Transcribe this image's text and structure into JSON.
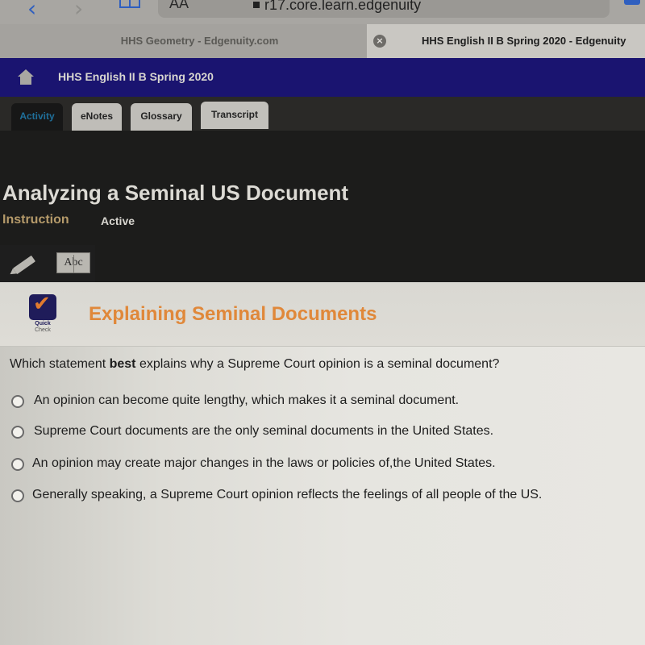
{
  "browser": {
    "toolbar": {
      "back_icon": "chevron-left",
      "forward_icon": "chevron-right",
      "bookmarks_icon": "open-book",
      "reader_label": "AA",
      "url": "r17.core.learn.edgenuity"
    },
    "tabs": [
      {
        "label": "HHS Geometry - Edgenuity.com",
        "active": false
      },
      {
        "label": "HHS English II B Spring 2020 - Edgenuity",
        "active": true,
        "close_icon": "x-circle"
      }
    ]
  },
  "course": {
    "home_icon": "home",
    "title": "HHS English II B Spring 2020"
  },
  "nav_tabs": [
    {
      "label": "Activity",
      "selected": true
    },
    {
      "label": "eNotes",
      "selected": false
    },
    {
      "label": "Glossary",
      "selected": false
    },
    {
      "label": "Transcript",
      "selected": false
    }
  ],
  "lesson": {
    "title": "Analyzing a Seminal US Document",
    "type": "Instruction",
    "status": "Active",
    "tools": [
      {
        "icon": "pencil",
        "name": "notes"
      },
      {
        "icon": "dictionary",
        "label": "Abc"
      }
    ]
  },
  "quick_check": {
    "badge_line1": "Quick",
    "badge_line2": "Check",
    "title": "Explaining Seminal Documents",
    "question_prefix": "Which statement ",
    "question_bold": "best",
    "question_suffix": " explains why a Supreme Court opinion is a seminal document?",
    "options": [
      "An opinion can become quite lengthy, which makes it a seminal document.",
      "Supreme Court documents are the only seminal documents in the United States.",
      "An opinion may create major changes in the laws or policies of,the United States.",
      "Generally speaking, a Supreme Court opinion reflects the feelings of all people of the US."
    ],
    "selected_option": null
  }
}
